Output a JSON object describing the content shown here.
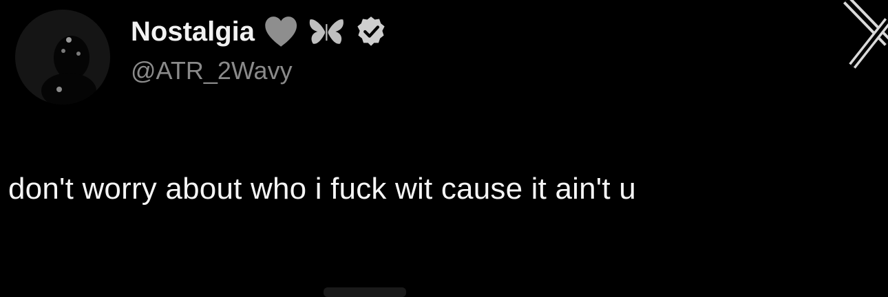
{
  "profile": {
    "display_name": "Nostalgia",
    "handle": "@ATR_2Wavy",
    "avatar_icon": "profile-photo-icon",
    "badges": [
      {
        "icon": "grey-heart-icon",
        "color": "#8e8e8e"
      },
      {
        "icon": "butterfly-icon",
        "color": "#bfbfbf"
      },
      {
        "icon": "verified-badge-icon",
        "color": "#cfcfcf"
      }
    ]
  },
  "tweet": {
    "text": "don't worry about who i fuck wit cause it ain't u"
  },
  "brand": {
    "logo_icon": "x-logo-icon",
    "logo_color": "#d9d9d9"
  },
  "colors": {
    "background": "#000000",
    "handle": "#8a8a8a",
    "text": "#f5f5f5"
  }
}
